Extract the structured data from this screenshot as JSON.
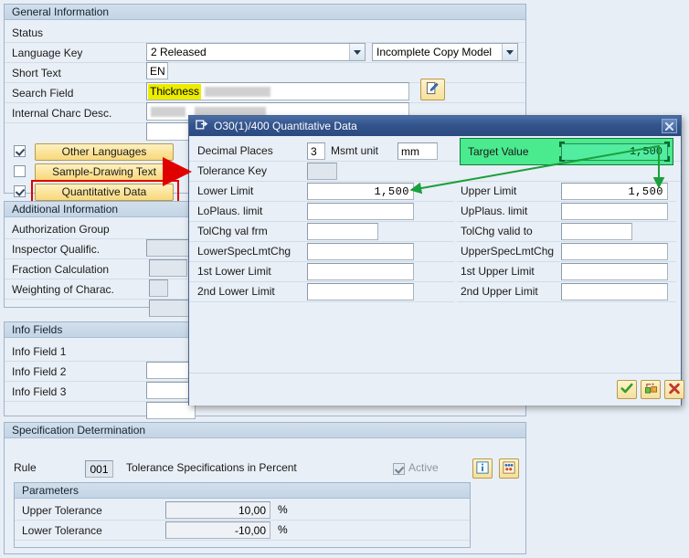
{
  "general": {
    "title": "General Information",
    "rows": [
      {
        "label": "Status"
      },
      {
        "label": "Language Key",
        "value": "EN"
      },
      {
        "label": "Short Text",
        "highlight": "Thickness"
      },
      {
        "label": "Search Field"
      },
      {
        "label": "Internal Charc Desc."
      }
    ],
    "status_dropdown": {
      "value": "2 Released"
    },
    "copy_model_dropdown": {
      "value": "Incomplete Copy Model"
    },
    "edit_icon": "pencil-icon"
  },
  "toggles": [
    {
      "label": "Other Languages",
      "checked": true
    },
    {
      "label": "Sample-Drawing Text",
      "checked": false
    },
    {
      "label": "Quantitative Data",
      "checked": true,
      "highlighted": true
    }
  ],
  "additional": {
    "title": "Additional Information",
    "rows": [
      {
        "label": "Authorization Group",
        "value": ""
      },
      {
        "label": "Inspector Qualific.",
        "value": ""
      },
      {
        "label": "Fraction Calculation",
        "value": ""
      },
      {
        "label": "Weighting of Charac.",
        "value": ""
      }
    ]
  },
  "info_fields": {
    "title": "Info Fields",
    "rows": [
      {
        "label": "Info Field 1",
        "value": ""
      },
      {
        "label": "Info Field 2",
        "value": ""
      },
      {
        "label": "Info Field 3",
        "value": ""
      }
    ]
  },
  "spec": {
    "title": "Specification Determination",
    "rule_label": "Rule",
    "rule_value": "001",
    "rule_text": "Tolerance Specifications in Percent",
    "active_label": "Active",
    "active_checked": true,
    "info_icon": "info-icon",
    "detail_icon": "details-icon",
    "parameters": {
      "title": "Parameters",
      "rows": [
        {
          "label": "Upper Tolerance",
          "value": "10,00",
          "unit": "%"
        },
        {
          "label": "Lower Tolerance",
          "value": "-10,00",
          "unit": "%"
        }
      ]
    }
  },
  "dialog": {
    "title": "O30(1)/400 Quantitative Data",
    "title_icon": "dialog-window-icon",
    "close_label": "✖",
    "decimal_places": {
      "label": "Decimal Places",
      "value": "3"
    },
    "msmt_unit": {
      "label": "Msmt unit",
      "value": "mm"
    },
    "target_value": {
      "label": "Target Value",
      "value": "1,500"
    },
    "tolerance_key": {
      "label": "Tolerance Key",
      "value": ""
    },
    "left_rows": [
      {
        "label": "Lower Limit",
        "value": "1,500"
      },
      {
        "label": "LoPlaus. limit",
        "value": ""
      },
      {
        "label": "TolChg val frm",
        "value": ""
      },
      {
        "label": "LowerSpecLmtChg",
        "value": ""
      },
      {
        "label": "1st Lower Limit",
        "value": ""
      },
      {
        "label": "2nd Lower Limit",
        "value": ""
      }
    ],
    "right_rows": [
      {
        "label": "Upper Limit",
        "value": "1,500"
      },
      {
        "label": "UpPlaus. limit",
        "value": ""
      },
      {
        "label": "TolChg valid to",
        "value": ""
      },
      {
        "label": "UpperSpecLmtChg",
        "value": ""
      },
      {
        "label": "1st Upper Limit",
        "value": ""
      },
      {
        "label": "2nd Upper Limit",
        "value": ""
      }
    ],
    "footer_buttons": [
      {
        "name": "continue-button",
        "icon": "green-check-icon"
      },
      {
        "name": "copy-button",
        "icon": "copy-enter-icon"
      },
      {
        "name": "cancel-button",
        "icon": "red-x-icon"
      }
    ]
  },
  "annotations": {
    "red_arrow": "red-arrow-to-dialog",
    "green_arrow_lower": "green-arrow-target-to-lower-limit",
    "green_arrow_upper": "green-arrow-target-to-upper-limit"
  },
  "colors": {
    "highlight_yellow": "#ecec00",
    "annotation_red": "#e00000",
    "annotation_green": "#1aa03c",
    "target_green": "#4aea8e",
    "amber_button": "#f7d87d",
    "dialog_blue": "#33548c"
  }
}
